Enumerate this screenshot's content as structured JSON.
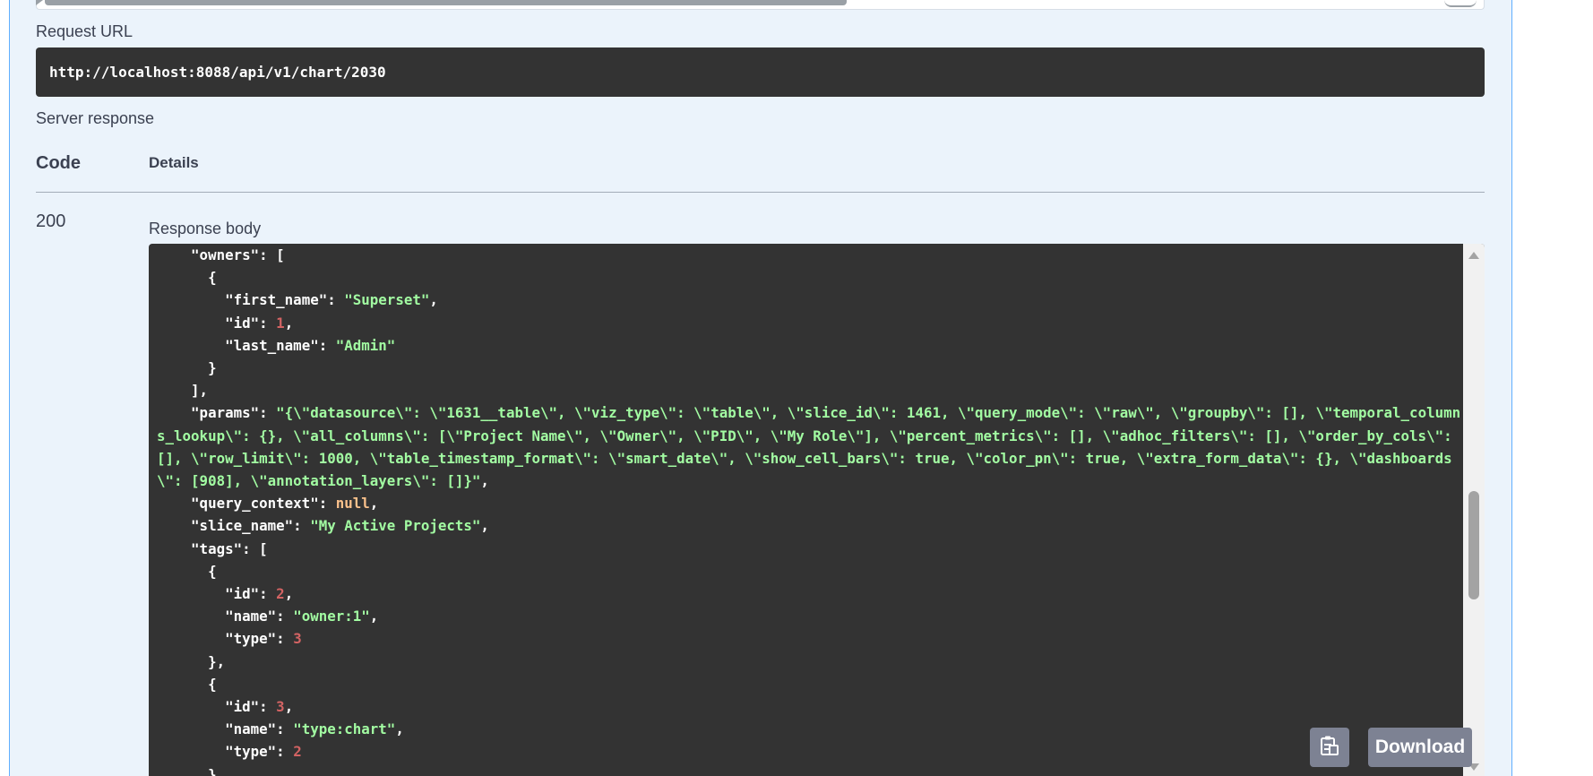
{
  "request_url": {
    "label": "Request URL",
    "value": "http://localhost:8088/api/v1/chart/2030"
  },
  "server_response": {
    "label": "Server response",
    "columns": {
      "code": "Code",
      "details": "Details"
    },
    "code_value": "200",
    "body_label": "Response body"
  },
  "response_lines": [
    [
      [
        "k",
        "    \"owners\": ["
      ]
    ],
    [
      [
        "k",
        "      {"
      ]
    ],
    [
      [
        "k",
        "        \"first_name\": "
      ],
      [
        "s",
        "\"Superset\""
      ],
      [
        "k",
        ","
      ]
    ],
    [
      [
        "k",
        "        \"id\": "
      ],
      [
        "n",
        "1"
      ],
      [
        "k",
        ","
      ]
    ],
    [
      [
        "k",
        "        \"last_name\": "
      ],
      [
        "s",
        "\"Admin\""
      ]
    ],
    [
      [
        "k",
        "      }"
      ]
    ],
    [
      [
        "k",
        "    ],"
      ]
    ],
    [
      [
        "k",
        "    \"params\": "
      ],
      [
        "s",
        "\"{\\\"datasource\\\": \\\"1631__table\\\", \\\"viz_type\\\": \\\"table\\\", \\\"slice_id\\\": 1461, \\\"query_mode\\\": \\\"raw\\\", \\\"groupby\\\": [], \\\"temporal_columns_lookup\\\": {}, \\\"all_columns\\\": [\\\"Project Name\\\", \\\"Owner\\\", \\\"PID\\\", \\\"My Role\\\"], \\\"percent_metrics\\\": [], \\\"adhoc_filters\\\": [], \\\"order_by_cols\\\": [], \\\"row_limit\\\": 1000, \\\"table_timestamp_format\\\": \\\"smart_date\\\", \\\"show_cell_bars\\\": true, \\\"color_pn\\\": true, \\\"extra_form_data\\\": {}, \\\"dashboards\\\": [908], \\\"annotation_layers\\\": []}\""
      ],
      [
        "k",
        ","
      ]
    ],
    [
      [
        "k",
        "    \"query_context\": "
      ],
      [
        "nl",
        "null"
      ],
      [
        "k",
        ","
      ]
    ],
    [
      [
        "k",
        "    \"slice_name\": "
      ],
      [
        "s",
        "\"My Active Projects\""
      ],
      [
        "k",
        ","
      ]
    ],
    [
      [
        "k",
        "    \"tags\": ["
      ]
    ],
    [
      [
        "k",
        "      {"
      ]
    ],
    [
      [
        "k",
        "        \"id\": "
      ],
      [
        "n",
        "2"
      ],
      [
        "k",
        ","
      ]
    ],
    [
      [
        "k",
        "        \"name\": "
      ],
      [
        "s",
        "\"owner:1\""
      ],
      [
        "k",
        ","
      ]
    ],
    [
      [
        "k",
        "        \"type\": "
      ],
      [
        "n",
        "3"
      ]
    ],
    [
      [
        "k",
        "      },"
      ]
    ],
    [
      [
        "k",
        "      {"
      ]
    ],
    [
      [
        "k",
        "        \"id\": "
      ],
      [
        "n",
        "3"
      ],
      [
        "k",
        ","
      ]
    ],
    [
      [
        "k",
        "        \"name\": "
      ],
      [
        "s",
        "\"type:chart\""
      ],
      [
        "k",
        ","
      ]
    ],
    [
      [
        "k",
        "        \"type\": "
      ],
      [
        "n",
        "2"
      ]
    ],
    [
      [
        "k",
        "      }"
      ]
    ]
  ],
  "buttons": {
    "copy_icon": "clipboard-icon",
    "download": "Download"
  },
  "colors": {
    "panel_bg": "#ebf3fb",
    "panel_border": "#61affe",
    "code_bg": "#333333",
    "string": "#a2fca2",
    "number": "#d36363",
    "null": "#fcc28c",
    "button_bg": "#7d8293"
  }
}
